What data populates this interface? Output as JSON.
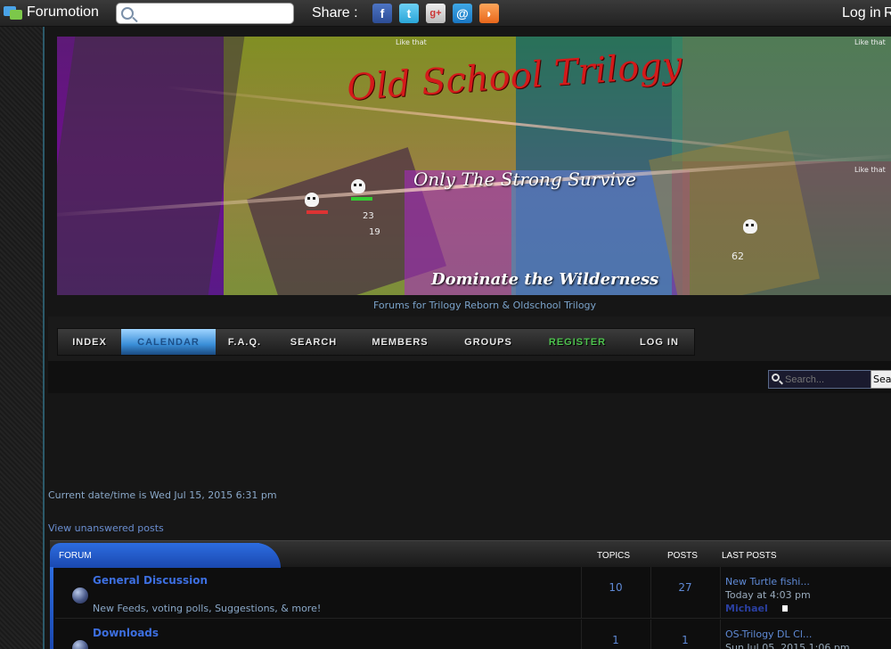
{
  "topbar": {
    "brand": "Forumotion",
    "search_placeholder": "",
    "share_label": "Share :",
    "share_icons": [
      "facebook-icon",
      "twitter-icon",
      "google-plus-icon",
      "email-icon",
      "rss-icon"
    ],
    "login": "Log in",
    "register": "R"
  },
  "banner": {
    "title": "Old School Trilogy",
    "subtitle": "Only The Strong Survive",
    "footer": "Dominate the Wilderness",
    "tag": "Like that",
    "hp_left": "23",
    "hp_left2": "19",
    "hp_right": "62"
  },
  "site_description": "Forums for Trilogy Reborn & Oldschool Trilogy",
  "nav": {
    "items": [
      {
        "label": "Index"
      },
      {
        "label": "Calendar"
      },
      {
        "label": "F.A.Q."
      },
      {
        "label": "Search"
      },
      {
        "label": "Members"
      },
      {
        "label": "Groups"
      },
      {
        "label": "Register"
      },
      {
        "label": "Log in"
      }
    ],
    "active": "Calendar"
  },
  "mini_search": {
    "placeholder": "Search...",
    "button": "Search"
  },
  "datetime": "Current date/time is Wed Jul 15, 2015 6:31 pm",
  "unanswered": "View unanswered posts",
  "forum": {
    "headers": {
      "forum": "FORUM",
      "topics": "TOPICS",
      "posts": "POSTS",
      "last": "LAST POSTS"
    },
    "rows": [
      {
        "title": "General Discussion",
        "description": "New Feeds, voting polls, Suggestions, & more!",
        "topics": "10",
        "posts": "27",
        "last_title": "New Turtle fishi...",
        "last_time": "Today at 4:03 pm",
        "last_user": "Michael"
      },
      {
        "title": "Downloads",
        "description": "",
        "topics": "1",
        "posts": "1",
        "last_title": "OS-Trilogy DL Cl...",
        "last_time": "Sun Jul 05, 2015 1:06 pm",
        "last_user": ""
      }
    ]
  },
  "colors": {
    "accent_blue": "#2d6de0",
    "link_blue": "#5f8ad6",
    "register_green": "#4ec24e",
    "banner_red": "#d41a1a"
  }
}
